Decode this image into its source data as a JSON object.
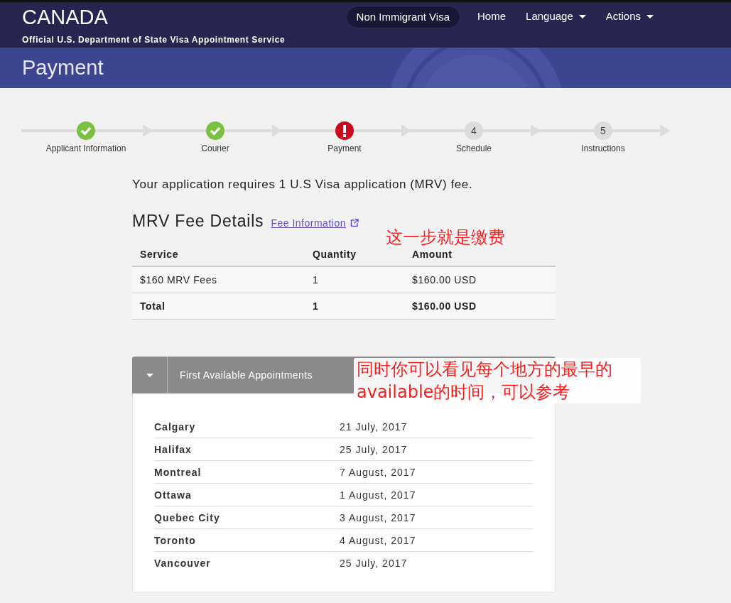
{
  "header": {
    "title": "CANADA",
    "subtitle": "Official U.S. Department of State Visa Appointment Service",
    "nav": [
      {
        "label": "Non Immigrant Visa",
        "kind": "pill",
        "dropdown": false
      },
      {
        "label": "Home",
        "kind": "link",
        "dropdown": false
      },
      {
        "label": "Language",
        "kind": "link",
        "dropdown": true
      },
      {
        "label": "Actions",
        "kind": "link",
        "dropdown": true
      }
    ]
  },
  "page_title": "Payment",
  "steps": [
    {
      "label": "Applicant Information",
      "done": true,
      "error": false
    },
    {
      "label": "Courier",
      "done": true,
      "error": false
    },
    {
      "label": "Payment",
      "done": false,
      "error": true
    },
    {
      "label": "Schedule",
      "done": false,
      "error": false,
      "number": "4"
    },
    {
      "label": "Instructions",
      "done": false,
      "error": false,
      "number": "5"
    }
  ],
  "intro": "Your application requires 1 U.S Visa application (MRV) fee.",
  "fee_section": {
    "heading": "MRV Fee Details",
    "link": "Fee Information"
  },
  "fee_table": {
    "columns": [
      "Service",
      "Quantity",
      "Amount"
    ],
    "rows": [
      [
        "$160 MRV Fees",
        "1",
        "$160.00 USD"
      ]
    ],
    "total": [
      "Total",
      "1",
      "$160.00 USD"
    ]
  },
  "appointments": {
    "title": "First Available Appointments",
    "expanded": true,
    "rows": [
      {
        "city": "Calgary",
        "date": "21 July, 2017"
      },
      {
        "city": "Halifax",
        "date": "25 July, 2017"
      },
      {
        "city": "Montreal",
        "date": "7 August, 2017"
      },
      {
        "city": "Ottawa",
        "date": "1 August, 2017"
      },
      {
        "city": "Quebec City",
        "date": "3 August, 2017"
      },
      {
        "city": "Toronto",
        "date": "4 August, 2017"
      },
      {
        "city": "Vancouver",
        "date": "25 July, 2017"
      }
    ]
  },
  "annotations": [
    "这一步就是缴费",
    "同时你可以看见每个地方的最早的available的时间，可以参考"
  ]
}
